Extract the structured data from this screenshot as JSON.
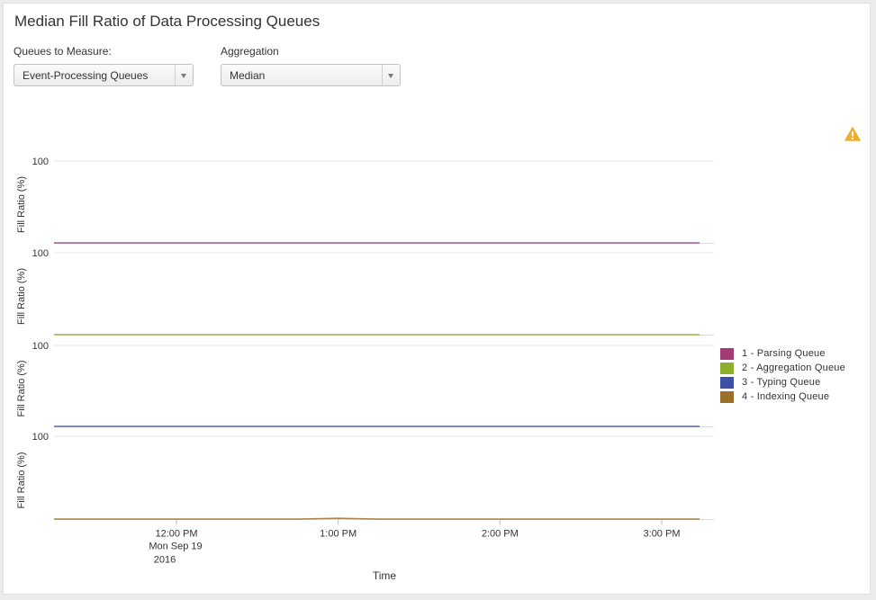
{
  "panel": {
    "title": "Median Fill Ratio of Data Processing Queues"
  },
  "controls": {
    "queues": {
      "label": "Queues to Measure:",
      "value": "Event-Processing Queues"
    },
    "aggregation": {
      "label": "Aggregation",
      "value": "Median"
    }
  },
  "icons": {
    "warning": "warning-triangle-icon"
  },
  "chart_data": {
    "type": "line",
    "layout": "stacked-panels",
    "xlabel": "Time",
    "ylabel": "Fill Ratio (%)",
    "ylim": [
      0,
      100
    ],
    "y_ticks": [
      "100"
    ],
    "x_ticks": [
      {
        "time": "12:00 PM",
        "line2": "Mon Sep 19",
        "line3": "2016"
      },
      {
        "time": "1:00 PM",
        "line2": "",
        "line3": ""
      },
      {
        "time": "2:00 PM",
        "line2": "",
        "line3": ""
      },
      {
        "time": "3:00 PM",
        "line2": "",
        "line3": ""
      }
    ],
    "x": [
      "11:15 AM",
      "11:30 AM",
      "11:45 AM",
      "12:00 PM",
      "12:15 PM",
      "12:30 PM",
      "12:45 PM",
      "1:00 PM",
      "1:15 PM",
      "1:30 PM",
      "1:45 PM",
      "2:00 PM",
      "2:15 PM",
      "2:30 PM",
      "2:45 PM",
      "3:00 PM",
      "3:15 PM"
    ],
    "grid": true,
    "legend_position": "right",
    "series": [
      {
        "name": "1 - Parsing Queue",
        "color": "#a33b75",
        "values": [
          0,
          0,
          0,
          0,
          0,
          0,
          0,
          0,
          0,
          0,
          0,
          0,
          0,
          0,
          0,
          0,
          0
        ]
      },
      {
        "name": "2 - Aggregation Queue",
        "color": "#8db02a",
        "values": [
          0,
          0,
          0,
          0,
          0,
          0,
          0,
          0,
          0,
          0,
          0,
          0,
          0,
          0,
          0,
          0,
          0
        ]
      },
      {
        "name": "3 - Typing Queue",
        "color": "#3d50a5",
        "values": [
          0,
          0,
          0,
          0,
          0,
          0,
          0,
          0,
          0,
          0,
          0,
          0,
          0,
          0,
          0,
          0,
          0
        ]
      },
      {
        "name": "4 - Indexing Queue",
        "color": "#9d6e2a",
        "values": [
          0,
          0,
          0,
          0,
          0,
          0,
          0,
          1,
          0,
          0,
          0,
          0,
          0,
          0,
          0,
          0,
          0
        ]
      }
    ]
  }
}
